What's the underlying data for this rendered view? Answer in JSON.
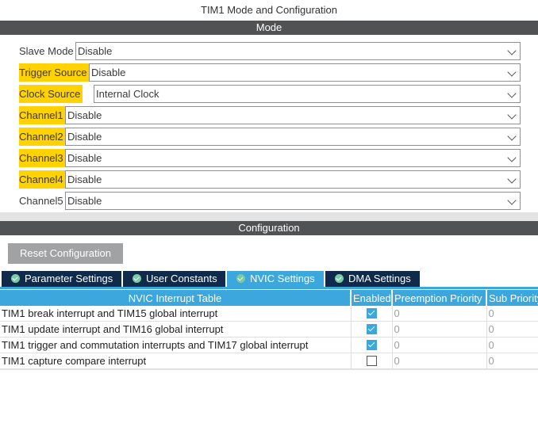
{
  "title": "TIM1 Mode and Configuration",
  "mode_header": "Mode",
  "config_header": "Configuration",
  "fields": [
    {
      "label": "Slave Mode",
      "value": "Disable",
      "highlight": false
    },
    {
      "label": "Trigger Source",
      "value": "Disable",
      "highlight": true
    },
    {
      "label": "Clock Source",
      "value": "Internal Clock",
      "highlight": true
    },
    {
      "label": "Channel1",
      "value": "Disable",
      "highlight": true
    },
    {
      "label": "Channel2",
      "value": "Disable",
      "highlight": true
    },
    {
      "label": "Channel3",
      "value": "Disable",
      "highlight": true
    },
    {
      "label": "Channel4",
      "value": "Disable",
      "highlight": true
    },
    {
      "label": "Channel5",
      "value": "Disable",
      "highlight": false
    }
  ],
  "reset_label": "Reset Configuration",
  "tabs": [
    {
      "label": "Parameter Settings",
      "active": false
    },
    {
      "label": "User Constants",
      "active": false
    },
    {
      "label": "NVIC Settings",
      "active": true
    },
    {
      "label": "DMA Settings",
      "active": false
    }
  ],
  "table": {
    "headers": [
      "NVIC Interrupt Table",
      "Enabled",
      "Preemption Priority",
      "Sub Priority"
    ],
    "rows": [
      {
        "name": "TIM1 break interrupt and TIM15 global interrupt",
        "enabled": true,
        "preemption": "0",
        "sub": "0"
      },
      {
        "name": "TIM1 update interrupt and TIM16 global interrupt",
        "enabled": true,
        "preemption": "0",
        "sub": "0"
      },
      {
        "name": "TIM1 trigger and commutation interrupts and TIM17 global interrupt",
        "enabled": true,
        "preemption": "0",
        "sub": "0"
      },
      {
        "name": "TIM1 capture compare interrupt",
        "enabled": false,
        "preemption": "0",
        "sub": "0"
      }
    ]
  }
}
